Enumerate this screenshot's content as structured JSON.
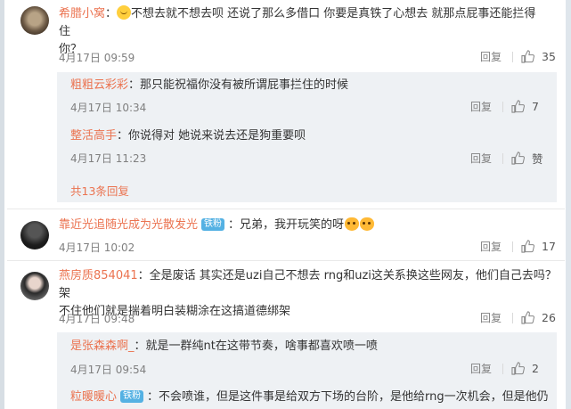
{
  "comments": [
    {
      "username": "希腊小窝",
      "text": "不想去就不想去呗 还说了那么多借口 你要是真铁了心想去 就那点屁事还能拦得住",
      "text2": "你？",
      "date": "4月17日 09:59",
      "reply_label": "回复",
      "likes": "35",
      "replies": [
        {
          "username": "粗粗云彩彩",
          "text": "那只能祝福你没有被所谓屁事拦住的时候",
          "date": "4月17日 10:34",
          "reply_label": "回复",
          "likes": "7"
        },
        {
          "username": "整活高手",
          "text": "你说得对 她说来说去还是狗重要呗",
          "date": "4月17日 11:23",
          "reply_label": "回复",
          "likes": "赞"
        }
      ],
      "more_replies": "共13条回复"
    },
    {
      "username": "靠近光追随光成为光散发光",
      "badge": "铁粉",
      "text": "兄弟，我开玩笑的呀",
      "date": "4月17日 10:02",
      "reply_label": "回复",
      "likes": "17"
    },
    {
      "username": "燕房质854041",
      "text": "全是废话 其实还是uzi自己不想去 rng和uzi这关系换这些网友，他们自己去吗？ 架",
      "text2": "不住他们就是揣着明白装糊涂在这搞道德绑架",
      "date": "4月17日 09:48",
      "reply_label": "回复",
      "likes": "26",
      "replies": [
        {
          "username": "是张森森啊_",
          "text": "就是一群纯nt在这带节奏，啥事都喜欢喷一喷",
          "date": "4月17日 09:54",
          "reply_label": "回复",
          "likes": "2"
        },
        {
          "username": "粒暖暖心",
          "badge": "铁粉",
          "text": "不会喷谁，但是这件事是给双方下场的台阶，是他给rng一次机会，但是他仍"
        }
      ]
    }
  ],
  "colors": {
    "username": "#eb7350",
    "badge": "#54b1e3",
    "subbox": "#eef1f4"
  }
}
